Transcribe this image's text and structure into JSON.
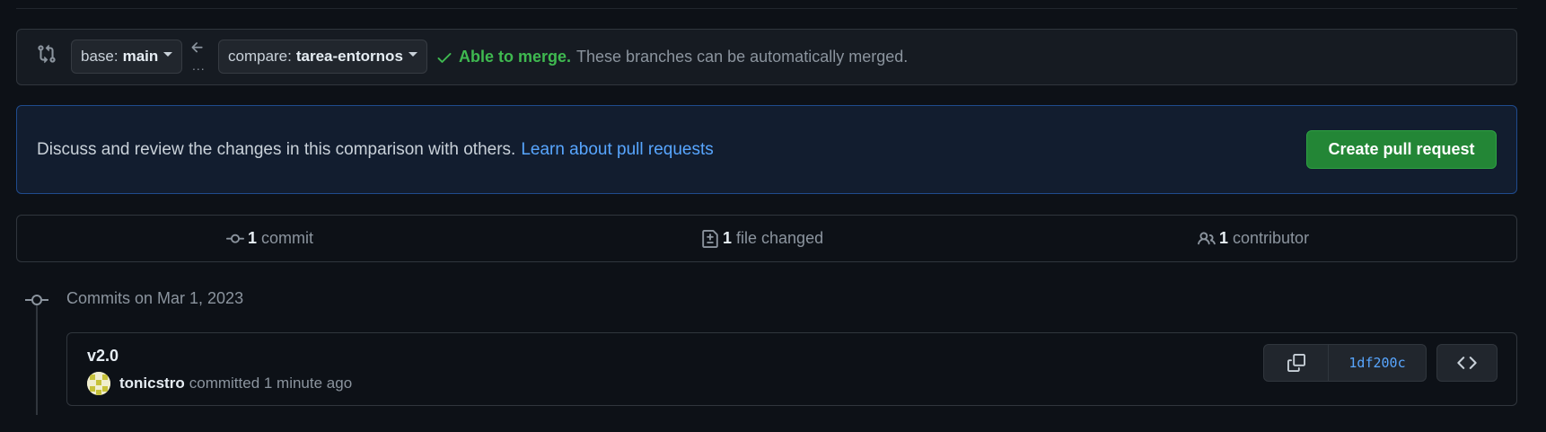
{
  "range_editor": {
    "base_prefix": "base:",
    "base_branch": "main",
    "compare_prefix": "compare:",
    "compare_branch": "tarea-entornos",
    "dots": "...",
    "merge_ok": "Able to merge.",
    "merge_message": "These branches can be automatically merged."
  },
  "banner": {
    "text": "Discuss and review the changes in this comparison with others.",
    "link": "Learn about pull requests",
    "create_button": "Create pull request"
  },
  "stats": {
    "commits_count": "1",
    "commits_label": "commit",
    "files_count": "1",
    "files_label": "file changed",
    "contributors_count": "1",
    "contributors_label": "contributor"
  },
  "timeline": {
    "date_heading": "Commits on Mar 1, 2023"
  },
  "commit": {
    "title": "v2.0",
    "author": "tonicstro",
    "action": "committed 1 minute ago",
    "sha": "1df200c"
  },
  "icons": {
    "range": "git-compare-icon",
    "arrow": "arrow-left-icon",
    "check": "check-icon",
    "commit": "git-commit-icon",
    "file": "file-diff-icon",
    "people": "people-icon",
    "copy": "copy-icon",
    "code": "code-icon"
  },
  "colors": {
    "background": "#0d1117",
    "success": "#3fb950",
    "link": "#58a6ff",
    "primary_button": "#238636"
  }
}
